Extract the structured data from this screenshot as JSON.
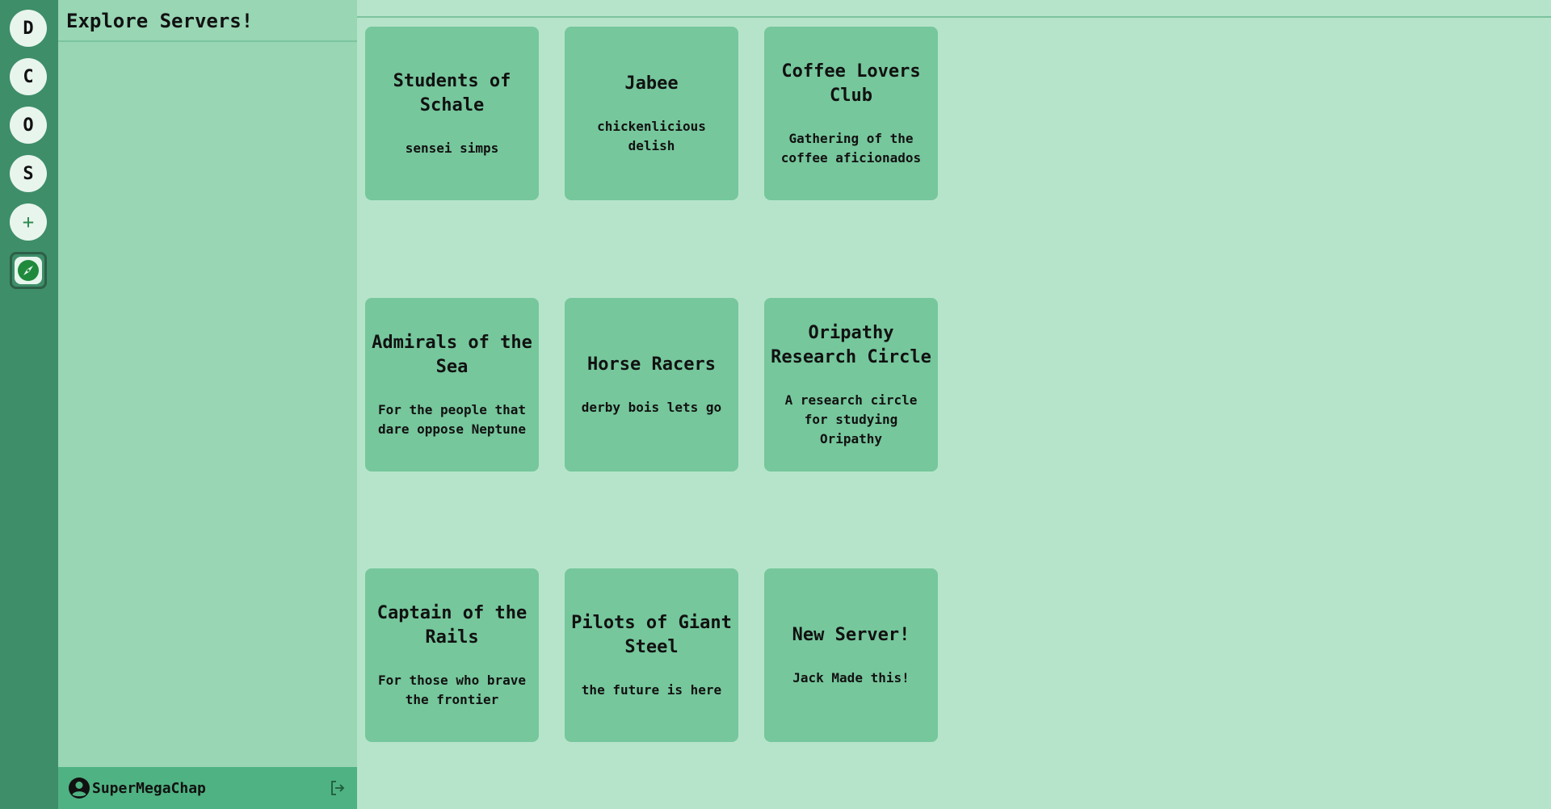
{
  "rail": {
    "servers": [
      "D",
      "C",
      "O",
      "S"
    ],
    "add_label": "+"
  },
  "sidebar": {
    "title": "Explore Servers!"
  },
  "user": {
    "name": "SuperMegaChap"
  },
  "servers": [
    {
      "name": "Students of Schale",
      "description": "sensei simps"
    },
    {
      "name": "Jabee",
      "description": "chickenlicious delish"
    },
    {
      "name": "Coffee Lovers Club",
      "description": "Gathering of the coffee aficionados"
    },
    {
      "name": "Admirals of the Sea",
      "description": "For the people that dare oppose Neptune"
    },
    {
      "name": "Horse Racers",
      "description": "derby bois lets go"
    },
    {
      "name": "Oripathy Research Circle",
      "description": "A research circle for studying Oripathy"
    },
    {
      "name": "Captain of the Rails",
      "description": "For those who brave the frontier"
    },
    {
      "name": "Pilots of Giant Steel",
      "description": "the future is here"
    },
    {
      "name": "New Server!",
      "description": "Jack Made this!"
    }
  ],
  "colors": {
    "rail": "#3e8e69",
    "sidebar": "#98d6b4",
    "main": "#b6e4ca",
    "card": "#76c79c",
    "user_bar": "#4fb282"
  },
  "icons": {
    "explore": "compass-icon",
    "avatar": "user-circle-icon",
    "logout": "logout-icon"
  }
}
